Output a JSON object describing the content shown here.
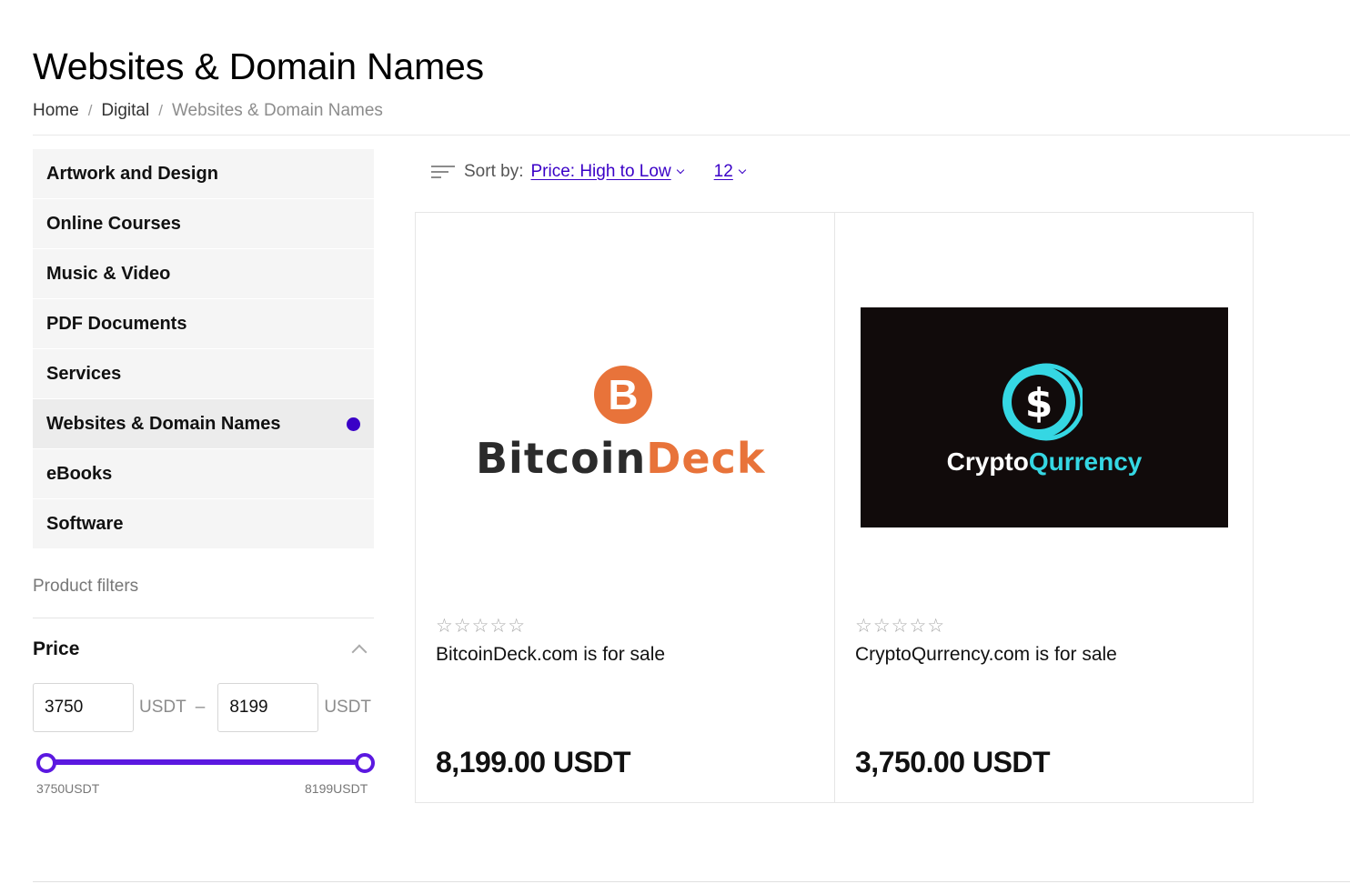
{
  "page": {
    "title": "Websites & Domain Names"
  },
  "breadcrumb": {
    "items": [
      "Home",
      "Digital"
    ],
    "separator": "/",
    "current": "Websites & Domain Names"
  },
  "categories": [
    {
      "label": "Artwork and Design",
      "active": false
    },
    {
      "label": "Online Courses",
      "active": false
    },
    {
      "label": "Music & Video",
      "active": false
    },
    {
      "label": "PDF Documents",
      "active": false
    },
    {
      "label": "Services",
      "active": false
    },
    {
      "label": "Websites & Domain Names",
      "active": true
    },
    {
      "label": "eBooks",
      "active": false
    },
    {
      "label": "Software",
      "active": false
    }
  ],
  "filters": {
    "label": "Product filters",
    "price": {
      "title": "Price",
      "min_value": "3750",
      "max_value": "8199",
      "unit": "USDT",
      "range_separator": "–",
      "slider_min_label": "3750USDT",
      "slider_max_label": "8199USDT",
      "selected_range_fraction": [
        0,
        1
      ]
    }
  },
  "sort": {
    "label": "Sort by:",
    "value": "Price: High to Low",
    "per_page": "12"
  },
  "products": [
    {
      "title": "BitcoinDeck.com is for sale",
      "price": "8,199.00 USDT",
      "rating_stars": "☆☆☆☆☆",
      "rating": 0,
      "logo": {
        "symbol": "B",
        "word_1": "Bitcoin",
        "word_2": "Deck",
        "colors": {
          "accent": "#e8733a",
          "text": "#2b2b2b"
        }
      }
    },
    {
      "title": "CryptoQurrency.com is for sale",
      "price": "3,750.00 USDT",
      "rating_stars": "☆☆☆☆☆",
      "rating": 0,
      "logo": {
        "symbol": "$",
        "word_1": "Crypto",
        "word_2": "Qurrency",
        "colors": {
          "accent": "#35d7e3",
          "background": "#110b0b",
          "text": "#ffffff"
        }
      }
    }
  ],
  "colors": {
    "accent": "#3a00c7",
    "slider": "#5b18e0"
  }
}
